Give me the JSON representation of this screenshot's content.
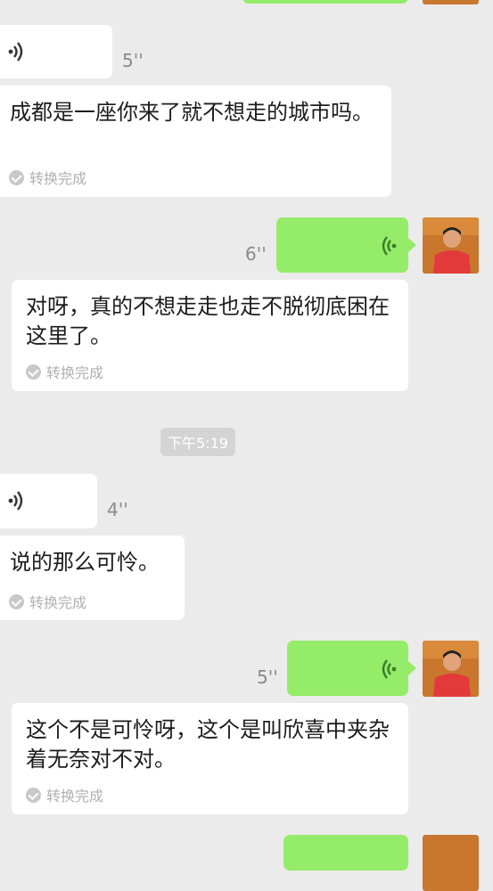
{
  "messages": [
    {
      "kind": "voice-in",
      "duration": "5''",
      "transcript": "成都是一座你来了就不想走的城市吗。",
      "status": "转换完成"
    },
    {
      "kind": "voice-out",
      "duration": "6''",
      "transcript": "对呀，真的不想走走也走不脱彻底困在这里了。",
      "status": "转换完成"
    },
    {
      "kind": "timestamp",
      "text": "下午5:19"
    },
    {
      "kind": "voice-in",
      "duration": "4''",
      "transcript": "说的那么可怜。",
      "status": "转换完成"
    },
    {
      "kind": "voice-out",
      "duration": "5''",
      "transcript": "这个不是可怜呀，这个是叫欣喜中夹杂着无奈对不对。",
      "status": "转换完成"
    }
  ],
  "colors": {
    "background": "#ebebeb",
    "outgoing_bubble": "#95ec69",
    "incoming_bubble": "#ffffff"
  },
  "icons": {
    "voice_in": "sound-wave-icon",
    "voice_out": "sound-wave-icon",
    "status": "check-circle-icon"
  }
}
